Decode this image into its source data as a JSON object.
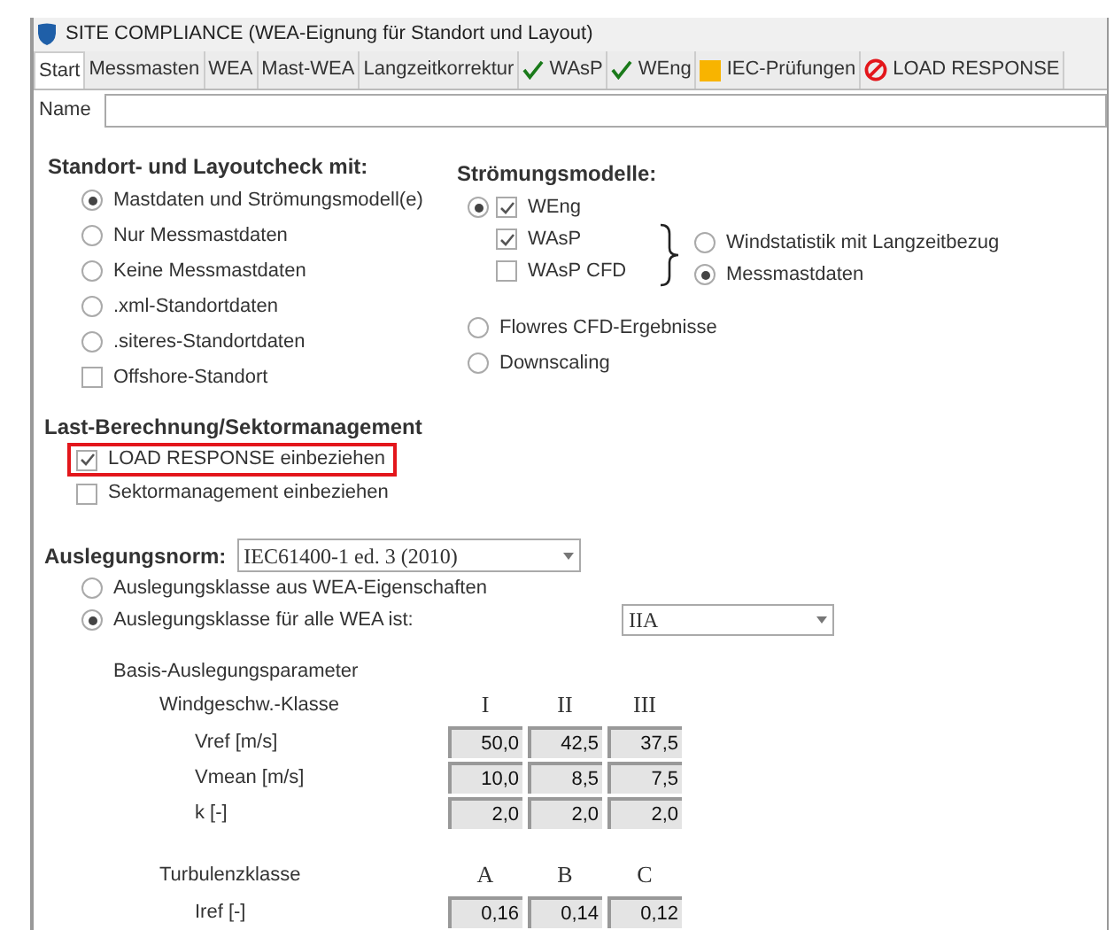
{
  "window": {
    "title": "SITE COMPLIANCE (WEA-Eignung für Standort und Layout)"
  },
  "tabs": [
    {
      "label": "Start",
      "selected": true,
      "kind": "plain"
    },
    {
      "label": "Messmasten",
      "selected": false,
      "kind": "plain"
    },
    {
      "label": "WEA",
      "selected": false,
      "kind": "plain"
    },
    {
      "label": "Mast-WEA",
      "selected": false,
      "kind": "plain"
    },
    {
      "label": "Langzeitkorrektur",
      "selected": false,
      "kind": "plain"
    },
    {
      "label": "WAsP",
      "selected": false,
      "kind": "ok"
    },
    {
      "label": "WEng",
      "selected": false,
      "kind": "ok"
    },
    {
      "label": "IEC-Prüfungen",
      "selected": false,
      "kind": "warning"
    },
    {
      "label": "LOAD RESPONSE",
      "selected": false,
      "kind": "error"
    }
  ],
  "name_field": {
    "label": "Name"
  },
  "check_basis": {
    "heading": "Standort- und Layoutcheck mit:",
    "options": [
      {
        "kind": "radio",
        "label": "Mastdaten und Strömungsmodell(e)",
        "selected": true
      },
      {
        "kind": "radio",
        "label": "Nur Messmastdaten",
        "selected": false
      },
      {
        "kind": "radio",
        "label": "Keine Messmastdaten",
        "selected": false
      },
      {
        "kind": "radio",
        "label": ".xml-Standortdaten",
        "selected": false
      },
      {
        "kind": "radio",
        "label": ".siteres-Standortdaten",
        "selected": false
      },
      {
        "kind": "checkbox",
        "label": "Offshore-Standort",
        "checked": false
      }
    ]
  },
  "flow_models": {
    "heading": "Strömungsmodelle:",
    "model_group": {
      "selected": true,
      "models": [
        {
          "label": "WEng",
          "checked": true
        },
        {
          "label": "WAsP",
          "checked": true
        },
        {
          "label": "WAsP CFD",
          "checked": false
        }
      ]
    },
    "wind_source": [
      {
        "label": "Windstatistik mit Langzeitbezug",
        "selected": false
      },
      {
        "label": "Messmastdaten",
        "selected": true
      }
    ],
    "alternatives": [
      {
        "label": "Flowres CFD-Ergebnisse",
        "selected": false
      },
      {
        "label": "Downscaling",
        "selected": false
      }
    ]
  },
  "load_section": {
    "heading": "Last-Berechnung/Sektormanagement",
    "options": [
      {
        "label": "LOAD RESPONSE einbeziehen",
        "checked": true,
        "highlighted": true
      },
      {
        "label": "Sektormanagement einbeziehen",
        "checked": false,
        "highlighted": false
      }
    ]
  },
  "design": {
    "label": "Auslegungsnorm:",
    "norm": "IEC61400-1 ed. 3 (2010)",
    "class_options": [
      {
        "label": "Auslegungsklasse aus WEA-Eigenschaften",
        "selected": false
      },
      {
        "label": "Auslegungsklasse für alle WEA ist:",
        "selected": true
      }
    ],
    "class_value": "IIA",
    "params_heading": "Basis-Auslegungsparameter",
    "wind_table": {
      "title": "Windgeschw.-Klasse",
      "columns": [
        "I",
        "II",
        "III"
      ],
      "rows": [
        {
          "label": "Vref [m/s]",
          "values": [
            "50,0",
            "42,5",
            "37,5"
          ]
        },
        {
          "label": "Vmean [m/s]",
          "values": [
            "10,0",
            "8,5",
            "7,5"
          ]
        },
        {
          "label": "k [-]",
          "values": [
            "2,0",
            "2,0",
            "2,0"
          ]
        }
      ]
    },
    "turbulence_table": {
      "title": "Turbulenzklasse",
      "columns": [
        "A",
        "B",
        "C"
      ],
      "rows": [
        {
          "label": "Iref [-]",
          "values": [
            "0,16",
            "0,14",
            "0,12"
          ]
        }
      ]
    }
  }
}
